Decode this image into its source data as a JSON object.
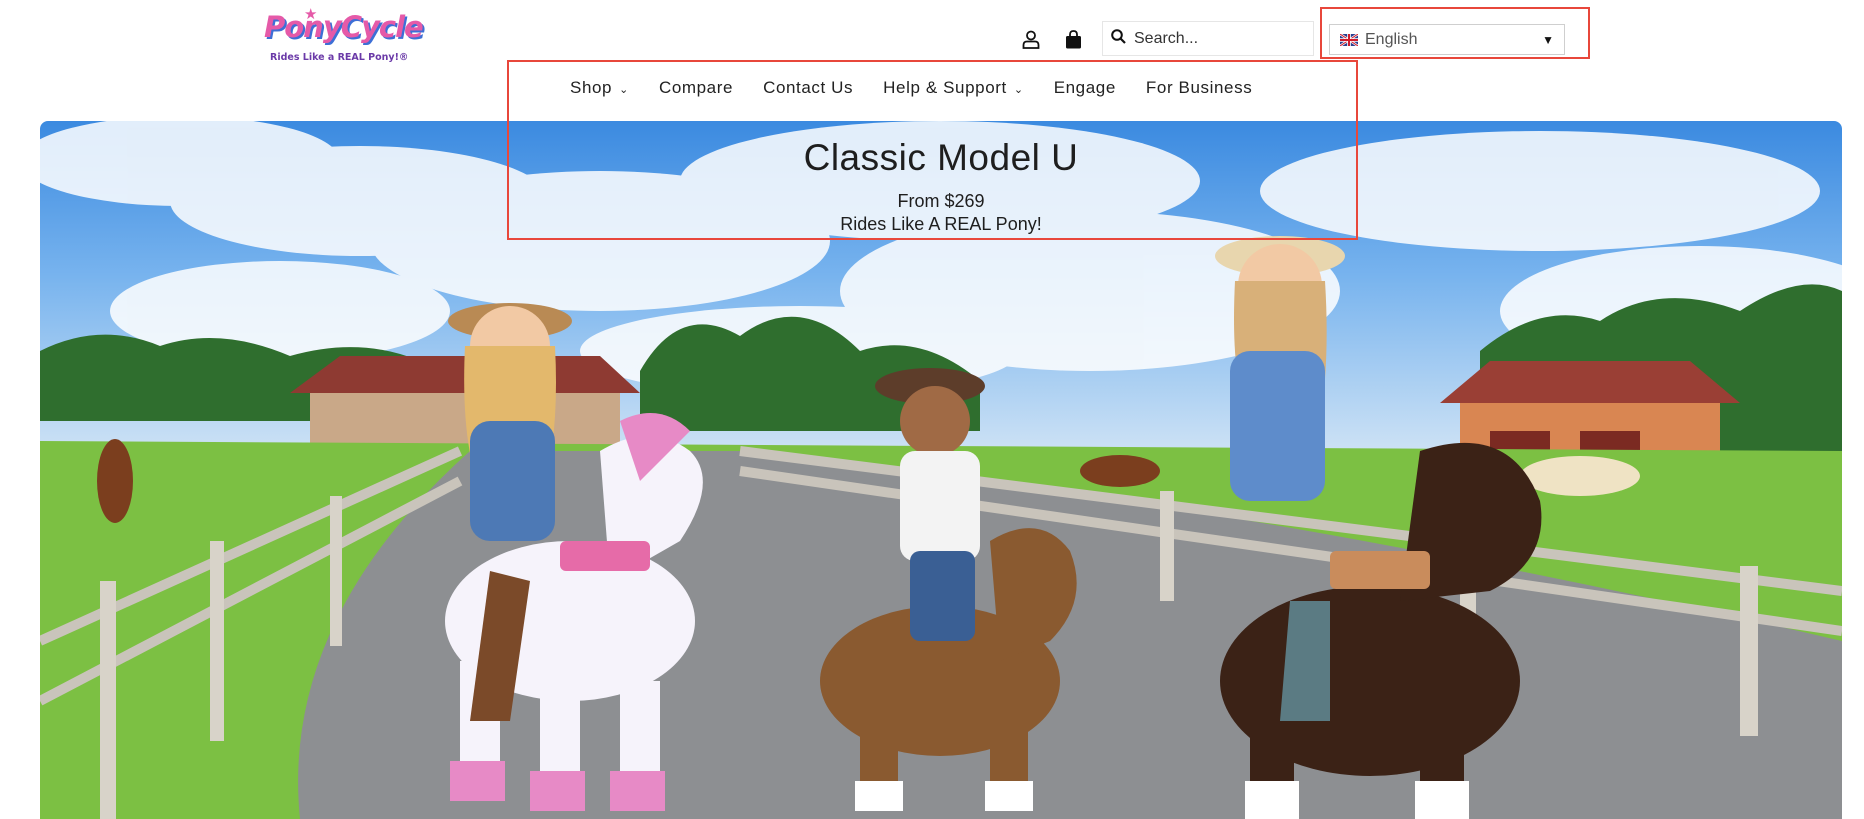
{
  "brand": {
    "logo_text": "PonyCycle",
    "tagline": "Rides Like a REAL Pony!®"
  },
  "header": {
    "search_placeholder": "Search...",
    "language": "English"
  },
  "nav": {
    "items": [
      {
        "label": "Shop",
        "has_dropdown": true
      },
      {
        "label": "Compare",
        "has_dropdown": false
      },
      {
        "label": "Contact Us",
        "has_dropdown": false
      },
      {
        "label": "Help & Support",
        "has_dropdown": true
      },
      {
        "label": "Engage",
        "has_dropdown": false
      },
      {
        "label": "For Business",
        "has_dropdown": false
      }
    ]
  },
  "hero": {
    "title": "Classic Model U",
    "price": "From $269",
    "tagline": "Rides Like A REAL Pony!"
  },
  "colors": {
    "highlight": "#e8473b",
    "logo_pink": "#e55aa8",
    "logo_blue": "#3d6fd6"
  }
}
